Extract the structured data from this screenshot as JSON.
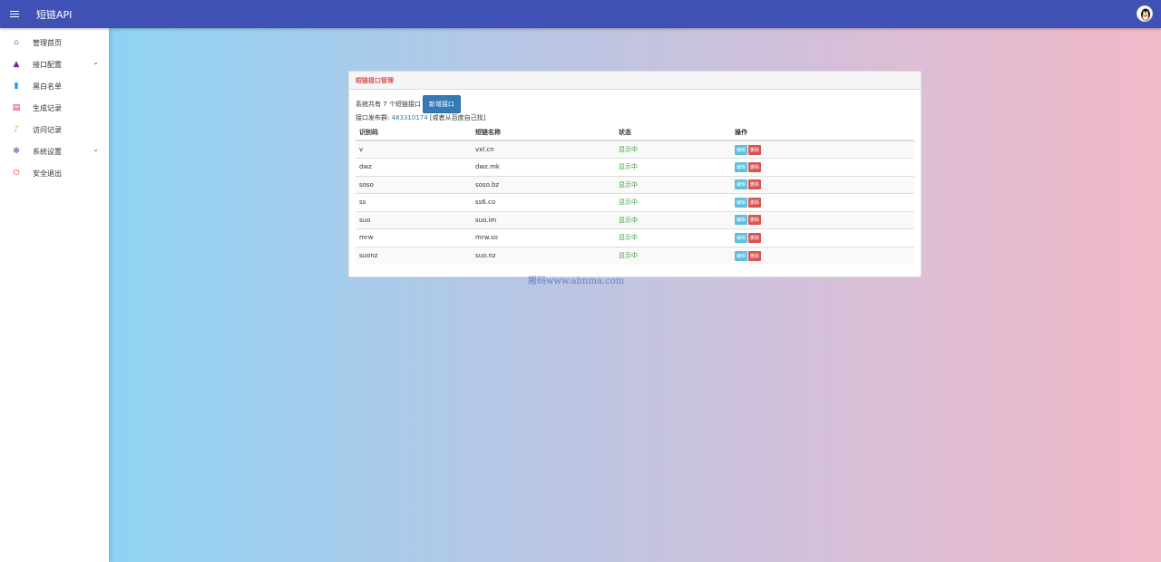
{
  "app": {
    "title": "短链API"
  },
  "sidebar": {
    "items": [
      {
        "label": "管理首页",
        "color": "#4caf50",
        "glyph": "⌂",
        "icon": "home-icon",
        "chevron": false
      },
      {
        "label": "接口配置",
        "color": "#7b1fa2",
        "glyph": "▲",
        "icon": "navigation-icon",
        "chevron": true
      },
      {
        "label": "黑白名单",
        "color": "#2196f3",
        "glyph": "▮",
        "icon": "book-icon",
        "chevron": false
      },
      {
        "label": "生成记录",
        "color": "#e91e63",
        "glyph": "▤",
        "icon": "card-icon",
        "chevron": false
      },
      {
        "label": "访问记录",
        "color": "#ff9800",
        "glyph": "♪",
        "icon": "bell-icon",
        "chevron": false
      },
      {
        "label": "系统设置",
        "color": "#3f51b5",
        "glyph": "✻",
        "icon": "gear-icon",
        "chevron": true
      },
      {
        "label": "安全退出",
        "color": "#f44336",
        "glyph": "⏻",
        "icon": "power-icon",
        "chevron": false
      }
    ]
  },
  "panel": {
    "title": "短链接口管理",
    "summary": "系统共有 7 个短链接口",
    "add_button": "新增接口",
    "group_label": "接口发布群: ",
    "group_number": "483310174",
    "group_suffix": " [或者从百度自己找]",
    "columns": [
      "识别码",
      "短链名称",
      "状态",
      "操作"
    ],
    "rows": [
      {
        "code": "v",
        "name": "vxl.cn",
        "status": "显示中"
      },
      {
        "code": "dwz",
        "name": "dwz.mk",
        "status": "显示中"
      },
      {
        "code": "soso",
        "name": "soso.bz",
        "status": "显示中"
      },
      {
        "code": "ss",
        "name": "ss6.co",
        "status": "显示中"
      },
      {
        "code": "suo",
        "name": "suo.im",
        "status": "显示中"
      },
      {
        "code": "mrw",
        "name": "mrw.so",
        "status": "显示中"
      },
      {
        "code": "suonz",
        "name": "suo.nz",
        "status": "显示中"
      }
    ],
    "edit_label": "编辑",
    "delete_label": "删除"
  },
  "watermark": "搬码www.abnma.com"
}
